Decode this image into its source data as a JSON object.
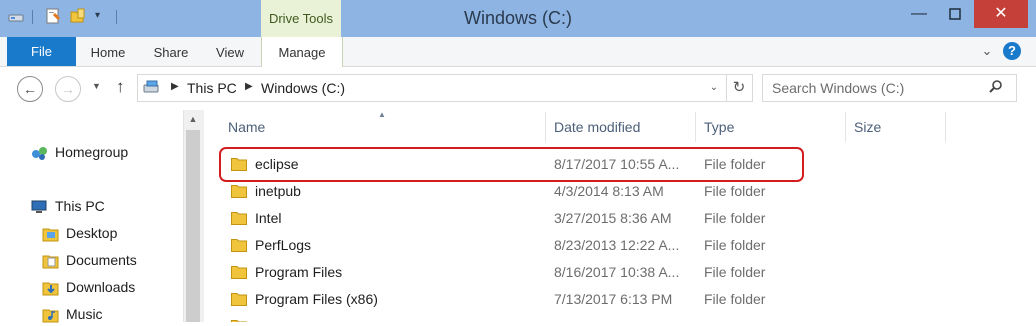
{
  "window": {
    "title": "Windows (C:)",
    "minimize_icon": "minimize-icon",
    "maximize_icon": "maximize-icon",
    "close_icon": "close-icon"
  },
  "ribbon": {
    "contextual_group": "Drive Tools",
    "tabs": [
      {
        "label": "File"
      },
      {
        "label": "Home"
      },
      {
        "label": "Share"
      },
      {
        "label": "View"
      },
      {
        "label": "Manage"
      }
    ]
  },
  "address_bar": {
    "breadcrumbs": [
      "This PC",
      "Windows (C:)"
    ]
  },
  "search": {
    "placeholder": "Search Windows (C:)"
  },
  "nav_pane": {
    "items": [
      {
        "label": "Homegroup",
        "icon": "homegroup-icon"
      },
      {
        "label": "This PC",
        "icon": "computer-icon"
      },
      {
        "label": "Desktop",
        "icon": "desktop-folder-icon"
      },
      {
        "label": "Documents",
        "icon": "documents-folder-icon"
      },
      {
        "label": "Downloads",
        "icon": "downloads-folder-icon"
      },
      {
        "label": "Music",
        "icon": "music-folder-icon"
      }
    ]
  },
  "file_list": {
    "columns": [
      "Name",
      "Date modified",
      "Type",
      "Size"
    ],
    "rows": [
      {
        "name": "eclipse",
        "date": "8/17/2017 10:55 A...",
        "type": "File folder"
      },
      {
        "name": "inetpub",
        "date": "4/3/2014 8:13 AM",
        "type": "File folder"
      },
      {
        "name": "Intel",
        "date": "3/27/2015 8:36 AM",
        "type": "File folder"
      },
      {
        "name": "PerfLogs",
        "date": "8/23/2013 12:22 A...",
        "type": "File folder"
      },
      {
        "name": "Program Files",
        "date": "8/16/2017 10:38 A...",
        "type": "File folder"
      },
      {
        "name": "Program Files (x86)",
        "date": "7/13/2017 6:13 PM",
        "type": "File folder"
      }
    ]
  },
  "colors": {
    "titlebar": "#8db4e2",
    "file_tab": "#1979ca",
    "highlight": "#d21e1e",
    "close_button": "#c6403a"
  }
}
